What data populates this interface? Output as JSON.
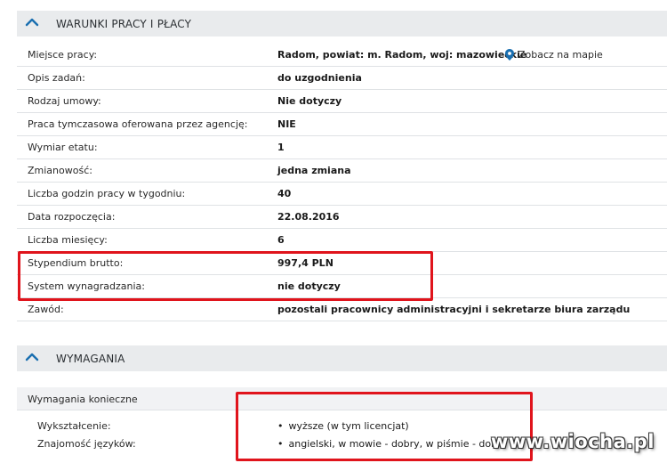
{
  "section_work": {
    "title": "WARUNKI PRACY I PŁACY",
    "map_link_label": "Zobacz na mapie",
    "rows": [
      {
        "label": "Miejsce pracy:",
        "value": "Radom, powiat: m. Radom, woj: mazowieckie"
      },
      {
        "label": "Opis zadań:",
        "value": "do uzgodnienia"
      },
      {
        "label": "Rodzaj umowy:",
        "value": "Nie dotyczy"
      },
      {
        "label": "Praca tymczasowa oferowana przez agencję:",
        "value": "NIE"
      },
      {
        "label": "Wymiar etatu:",
        "value": "1"
      },
      {
        "label": "Zmianowość:",
        "value": "jedna zmiana"
      },
      {
        "label": "Liczba godzin pracy w tygodniu:",
        "value": "40"
      },
      {
        "label": "Data rozpoczęcia:",
        "value": "22.08.2016"
      },
      {
        "label": "Liczba miesięcy:",
        "value": "6"
      },
      {
        "label": "Stypendium brutto:",
        "value": "997,4 PLN"
      },
      {
        "label": "System wynagradzania:",
        "value": "nie dotyczy"
      },
      {
        "label": "Zawód:",
        "value": "pozostali pracownicy administracyjni i sekretarze biura zarządu"
      }
    ]
  },
  "section_requirements": {
    "title": "WYMAGANIA",
    "subheader": "Wymagania konieczne",
    "rows": [
      {
        "label": "Wykształcenie:",
        "value": "wyższe (w tym licencjat)"
      },
      {
        "label": "Znajomość języków:",
        "value": "angielski, w mowie - dobry, w piśmie - dobry"
      }
    ]
  },
  "watermark": "www.wiocha.pl",
  "colors": {
    "accent": "#1a6fb0",
    "header_bg": "#e9ebed",
    "highlight_box": "#e0141c"
  }
}
